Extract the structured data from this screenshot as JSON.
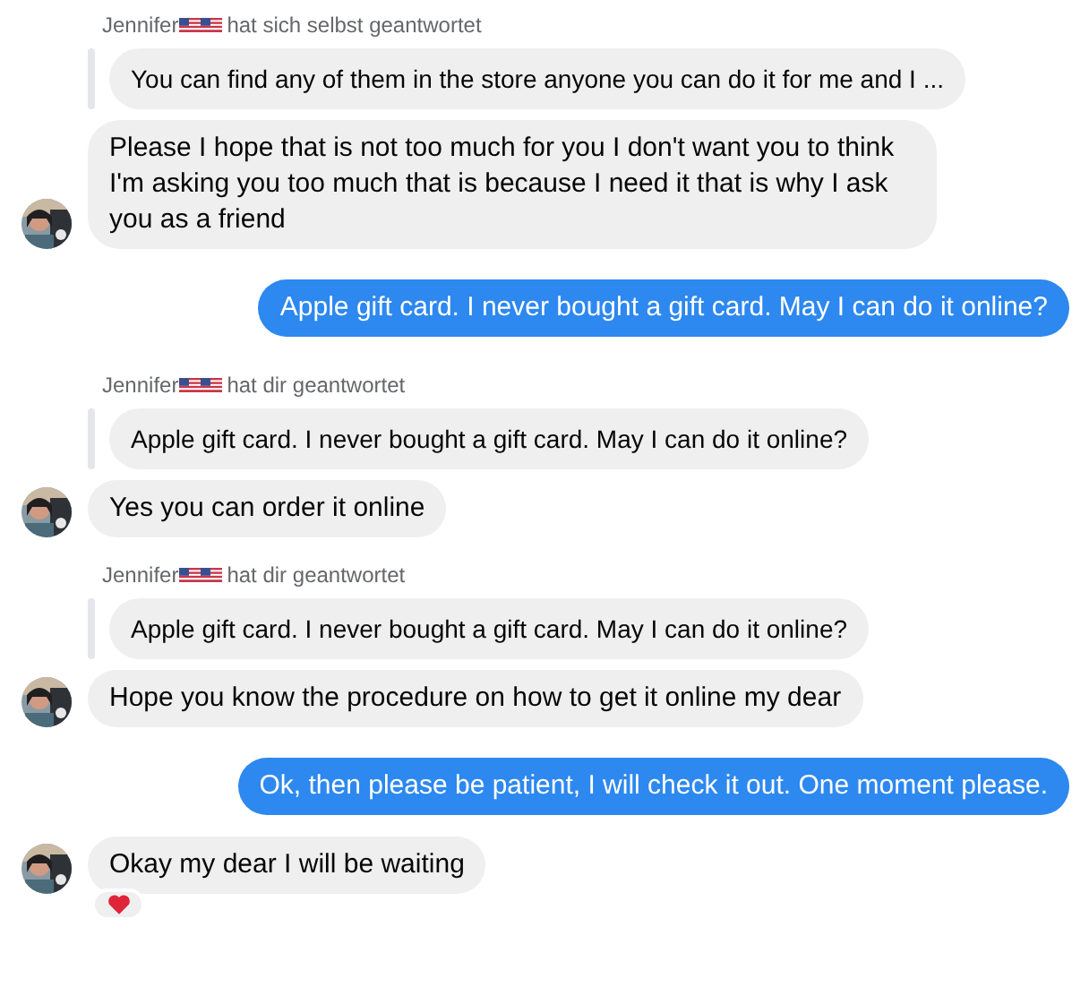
{
  "messages": [
    {
      "kind": "reply_header",
      "name": "Jennifer",
      "text": "hat sich selbst geantwortet"
    },
    {
      "kind": "quote",
      "text": "You can find any of them in the store anyone you can do it for me and I ..."
    },
    {
      "kind": "incoming",
      "text": "Please I hope that is not too much for you I don't want you to think I'm asking you too much that is because I need it that is why I ask you as a friend"
    },
    {
      "kind": "outgoing",
      "text": "Apple gift card. I never bought a gift card. May I can do it online?"
    },
    {
      "kind": "reply_header",
      "name": "Jennifer",
      "text": "hat dir geantwortet"
    },
    {
      "kind": "quote",
      "text": "Apple gift card. I never bought a gift card. May I can do it online?"
    },
    {
      "kind": "incoming",
      "text": "Yes you can order it online"
    },
    {
      "kind": "reply_header",
      "name": "Jennifer",
      "text": "hat dir geantwortet"
    },
    {
      "kind": "quote",
      "text": "Apple gift card. I never bought a gift card. May I can do it online?"
    },
    {
      "kind": "incoming",
      "text": "Hope you know the procedure on how to get it online my dear"
    },
    {
      "kind": "outgoing",
      "text": "Ok, then please be patient, I will check it out. One moment please."
    },
    {
      "kind": "incoming",
      "text": "Okay my dear I will be waiting",
      "reacted": true
    }
  ]
}
